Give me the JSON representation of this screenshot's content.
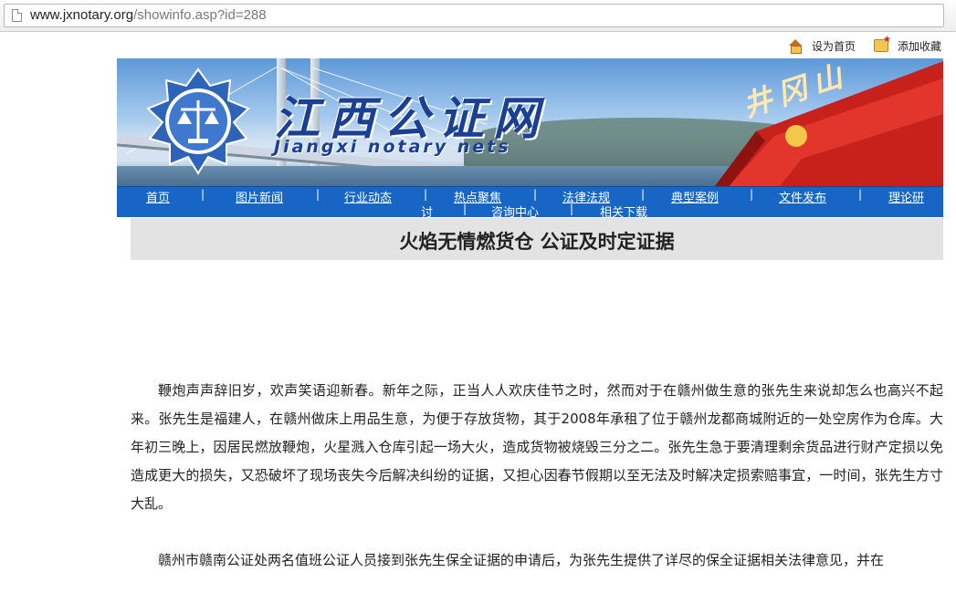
{
  "browser": {
    "url_host": "www.jxnotary.org",
    "url_path": "/showinfo.asp?id=288"
  },
  "toplinks": {
    "home": "设为首页",
    "favorite": "添加收藏"
  },
  "banner": {
    "title": "江西公证网",
    "subtitle": "Jiangxi notary nets",
    "right_text": "井冈山"
  },
  "nav": {
    "items": [
      "首页",
      "图片新闻",
      "行业动态",
      "热点聚焦",
      "法律法规",
      "典型案例",
      "文件发布",
      "理论研讨",
      "咨询中心",
      "相关下载"
    ],
    "separator": "|"
  },
  "article": {
    "title": "火焰无情燃货仓  公证及时定证据",
    "paragraphs": [
      "鞭炮声声辞旧岁，欢声笑语迎新春。新年之际，正当人人欢庆佳节之时，然而对于在赣州做生意的张先生来说却怎么也高兴不起来。张先生是福建人，在赣州做床上用品生意，为便于存放货物，其于2008年承租了位于赣州龙都商城附近的一处空房作为仓库。大年初三晚上，因居民燃放鞭炮，火星溅入仓库引起一场大火，造成货物被烧毁三分之二。张先生急于要清理剩余货品进行财产定损以免造成更大的损失，又恐破坏了现场丧失今后解决纠纷的证据，又担心因春节假期以至无法及时解决定损索赔事宜，一时间，张先生方寸大乱。",
      "赣州市赣南公证处两名值班公证人员接到张先生保全证据的申请后，为张先生提供了详尽的保全证据相关法律意见，并在"
    ]
  },
  "colors": {
    "nav_bg": "#1766c6",
    "title_bar_bg": "#e3e3e3",
    "brand_blue": "#1b3f93"
  }
}
